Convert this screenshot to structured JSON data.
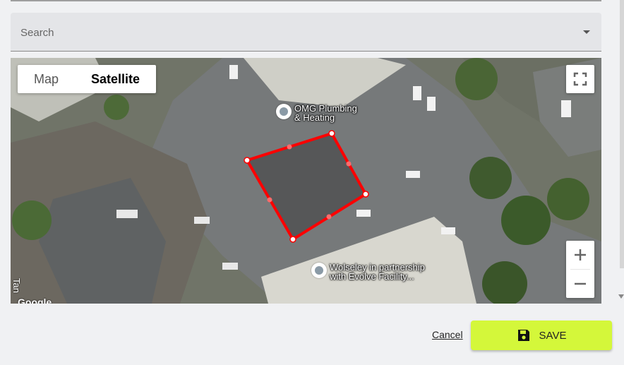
{
  "search": {
    "placeholder": "Search"
  },
  "map": {
    "type_control": {
      "map_label": "Map",
      "satellite_label": "Satellite",
      "selected": "Satellite"
    },
    "places": [
      {
        "name": "OMG Plumbing\n& Heating"
      },
      {
        "name": "Wolseley in partnership\nwith Evolve Facility..."
      }
    ],
    "street_label": "Tan",
    "attribution": "Google",
    "polygon_color": "#ff0000",
    "zoom_in_label": "+",
    "zoom_out_label": "−"
  },
  "actions": {
    "cancel_label": "Cancel",
    "save_label": "SAVE",
    "save_color": "#d4f73a"
  }
}
